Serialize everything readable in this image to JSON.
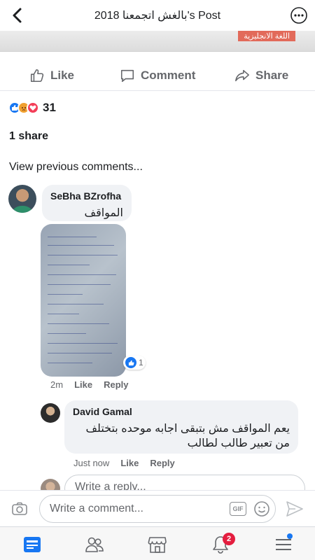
{
  "header": {
    "title": "بالغش اتجمعنا 2018's Post"
  },
  "post_image": {
    "tag_text": "اللغة الانجليزية"
  },
  "actions": {
    "like_label": "Like",
    "comment_label": "Comment",
    "share_label": "Share"
  },
  "reactions": {
    "count": "31",
    "types": [
      "like",
      "angry",
      "love"
    ]
  },
  "shares": {
    "text": "1 share"
  },
  "comments": {
    "view_previous": "View previous comments...",
    "items": [
      {
        "author": "SeBha BZrofha",
        "text": "المواقف",
        "has_photo": true,
        "reaction_count": "1",
        "time": "2m",
        "like_label": "Like",
        "reply_label": "Reply",
        "replies": [
          {
            "author": "David Gamal",
            "text": "يعم المواقف مش بتبقى اجابه موحده بتختلف من تعبير طالب لطالب",
            "time": "Just now",
            "like_label": "Like",
            "reply_label": "Reply"
          }
        ]
      }
    ],
    "reply_placeholder": "Write a reply..."
  },
  "composer": {
    "placeholder": "Write a comment...",
    "gif_label": "GIF"
  },
  "tabbar": {
    "notifications_badge": "2"
  },
  "colors": {
    "accent": "#1877f2",
    "muted": "#65676b",
    "bubble": "#f0f2f5",
    "badge": "#e41e3f"
  }
}
